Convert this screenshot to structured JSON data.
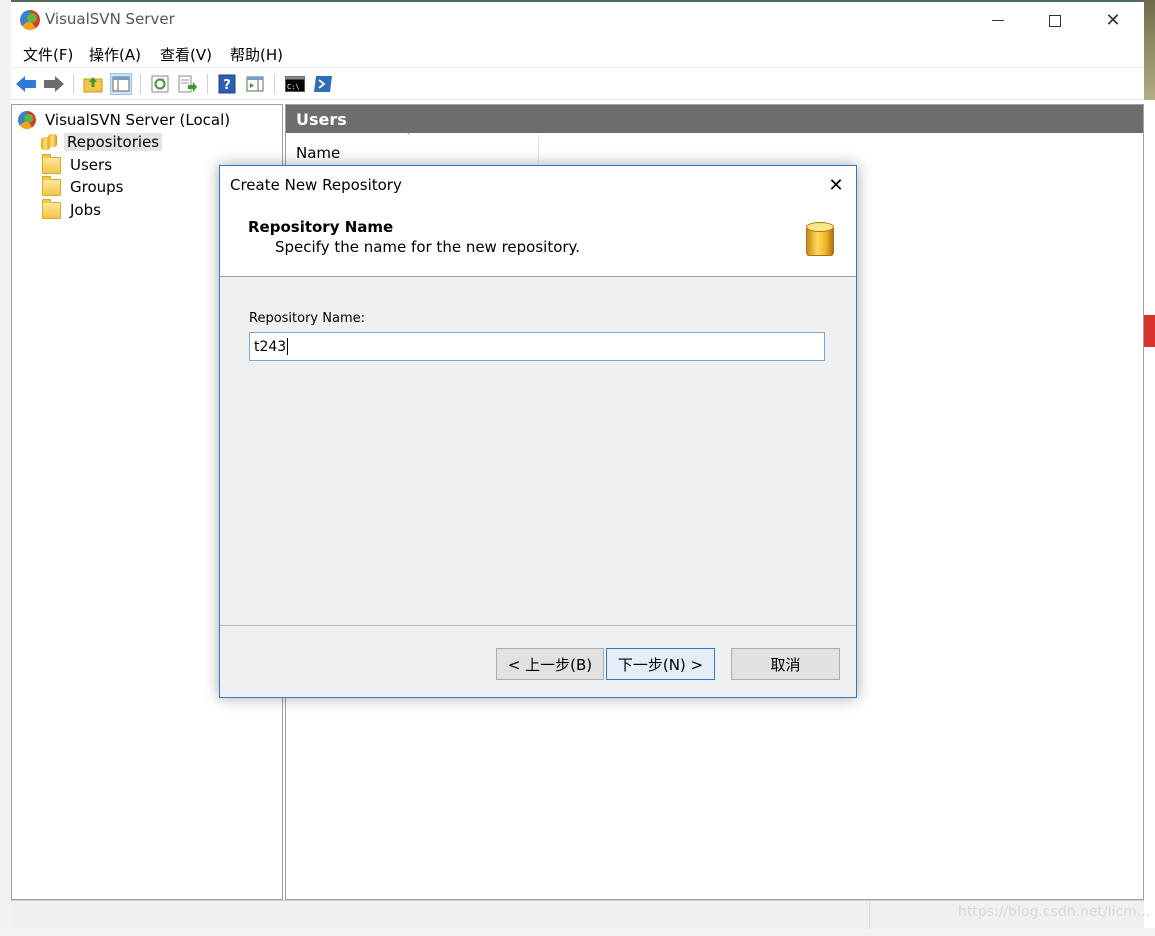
{
  "window": {
    "title": "VisualSVN Server",
    "controls": [
      "minimize-icon",
      "maximize-icon",
      "close-icon"
    ]
  },
  "menu": [
    {
      "label": "文件(F)"
    },
    {
      "label": "操作(A)"
    },
    {
      "label": "查看(V)"
    },
    {
      "label": "帮助(H)"
    }
  ],
  "toolbar": {
    "icons": [
      "back-icon",
      "forward-icon",
      "up-folder-icon",
      "show-tree-icon",
      "refresh-icon",
      "export-icon",
      "help-icon",
      "action-pane-icon",
      "cmd-icon",
      "powershell-icon"
    ]
  },
  "tree": {
    "root": "VisualSVN Server (Local)",
    "items": [
      {
        "label": "Repositories",
        "selected": true
      },
      {
        "label": "Users"
      },
      {
        "label": "Groups"
      },
      {
        "label": "Jobs"
      }
    ]
  },
  "content": {
    "header": "Users",
    "columns": [
      "Name"
    ]
  },
  "watermark": "https://blog.csdn.net/licm...",
  "dialog": {
    "title": "Create New Repository",
    "heading": "Repository Name",
    "subheading": "Specify the name for the new repository.",
    "field_label": "Repository Name:",
    "field_value": "t243",
    "buttons": {
      "back": "< 上一步(B)",
      "next": "下一步(N) >",
      "cancel": "取消"
    }
  },
  "colors": {
    "header_bg": "#6d6d6d",
    "accent": "#2b7ad6",
    "dialog_bg": "#f0f0f0"
  }
}
